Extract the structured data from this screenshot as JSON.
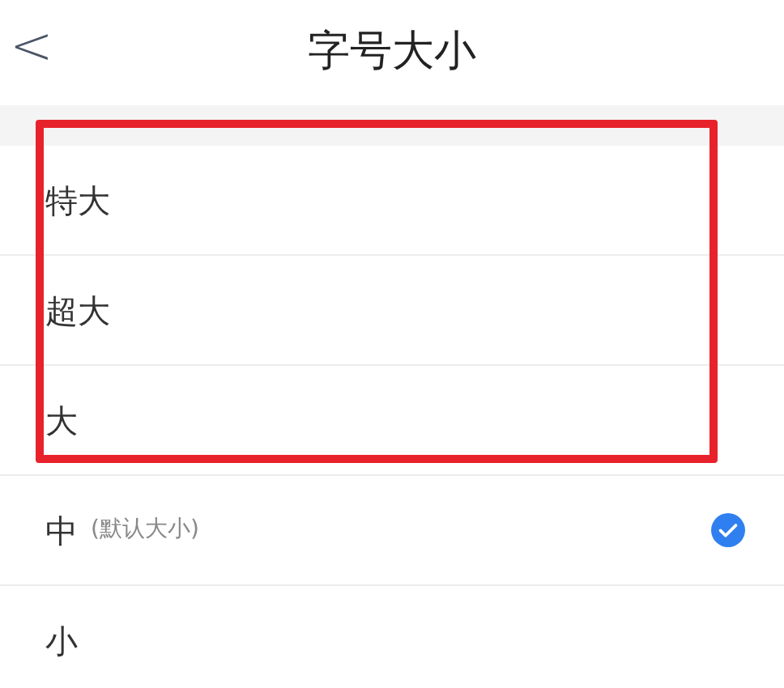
{
  "header": {
    "back": "<",
    "title": "字号大小"
  },
  "options": [
    {
      "label": "特大",
      "selected": false
    },
    {
      "label": "超大",
      "selected": false
    },
    {
      "label": "大",
      "selected": false
    },
    {
      "label": "中",
      "note": "(默认大小)",
      "selected": true
    },
    {
      "label": "小",
      "selected": false
    }
  ]
}
